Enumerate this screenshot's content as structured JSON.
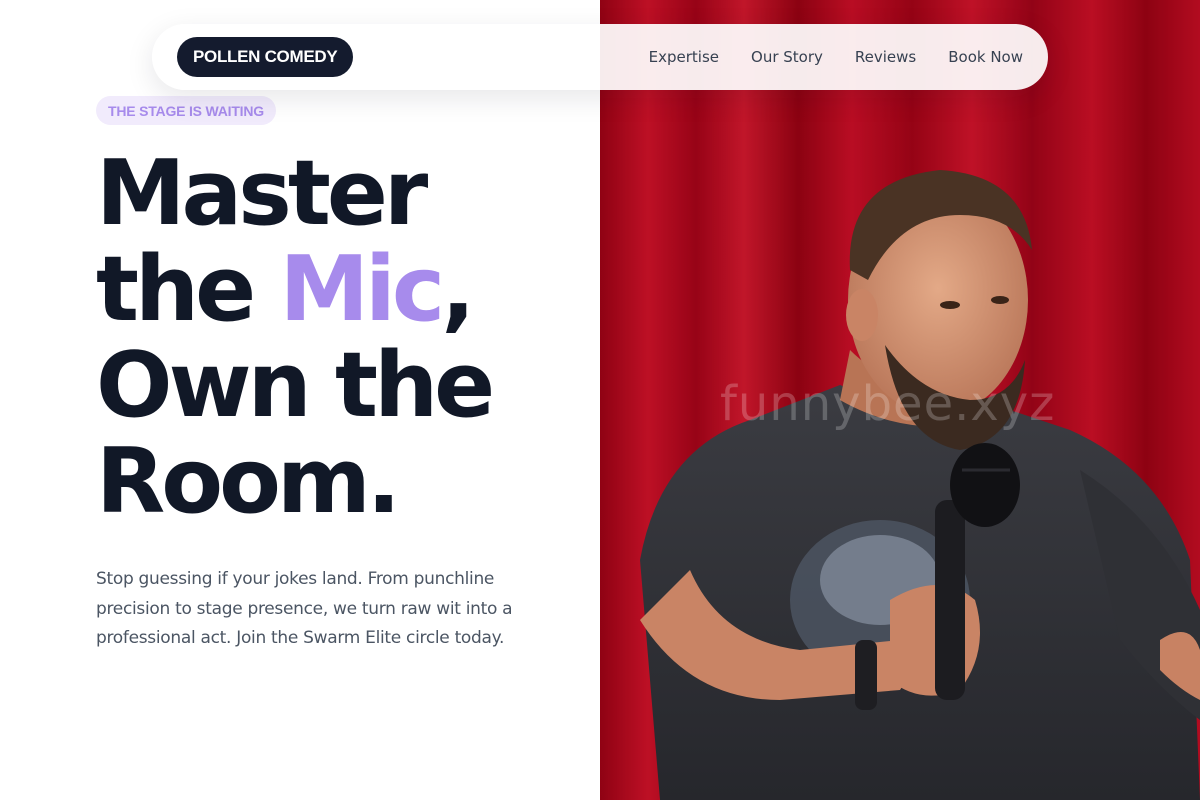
{
  "nav": {
    "logo": "POLLEN COMEDY",
    "links": [
      "Expertise",
      "Our Story",
      "Reviews",
      "Book Now"
    ]
  },
  "hero": {
    "badge": "THE STAGE IS WAITING",
    "headline": {
      "line1": "Master",
      "line2_pre": "the ",
      "line2_accent": "Mic",
      "line2_post": ",",
      "line3": "Own the",
      "line4": "Room."
    },
    "subtext": "Stop guessing if your jokes land. From punchline precision to stage presence, we turn raw wit into a professional act. Join the Swarm Elite circle today."
  },
  "image": {
    "description_icon": "comedian-photo",
    "watermark": "funnybee.xyz"
  },
  "colors": {
    "accent": "#a78bec",
    "dark": "#141b2e",
    "curtain": "#b5051b"
  }
}
